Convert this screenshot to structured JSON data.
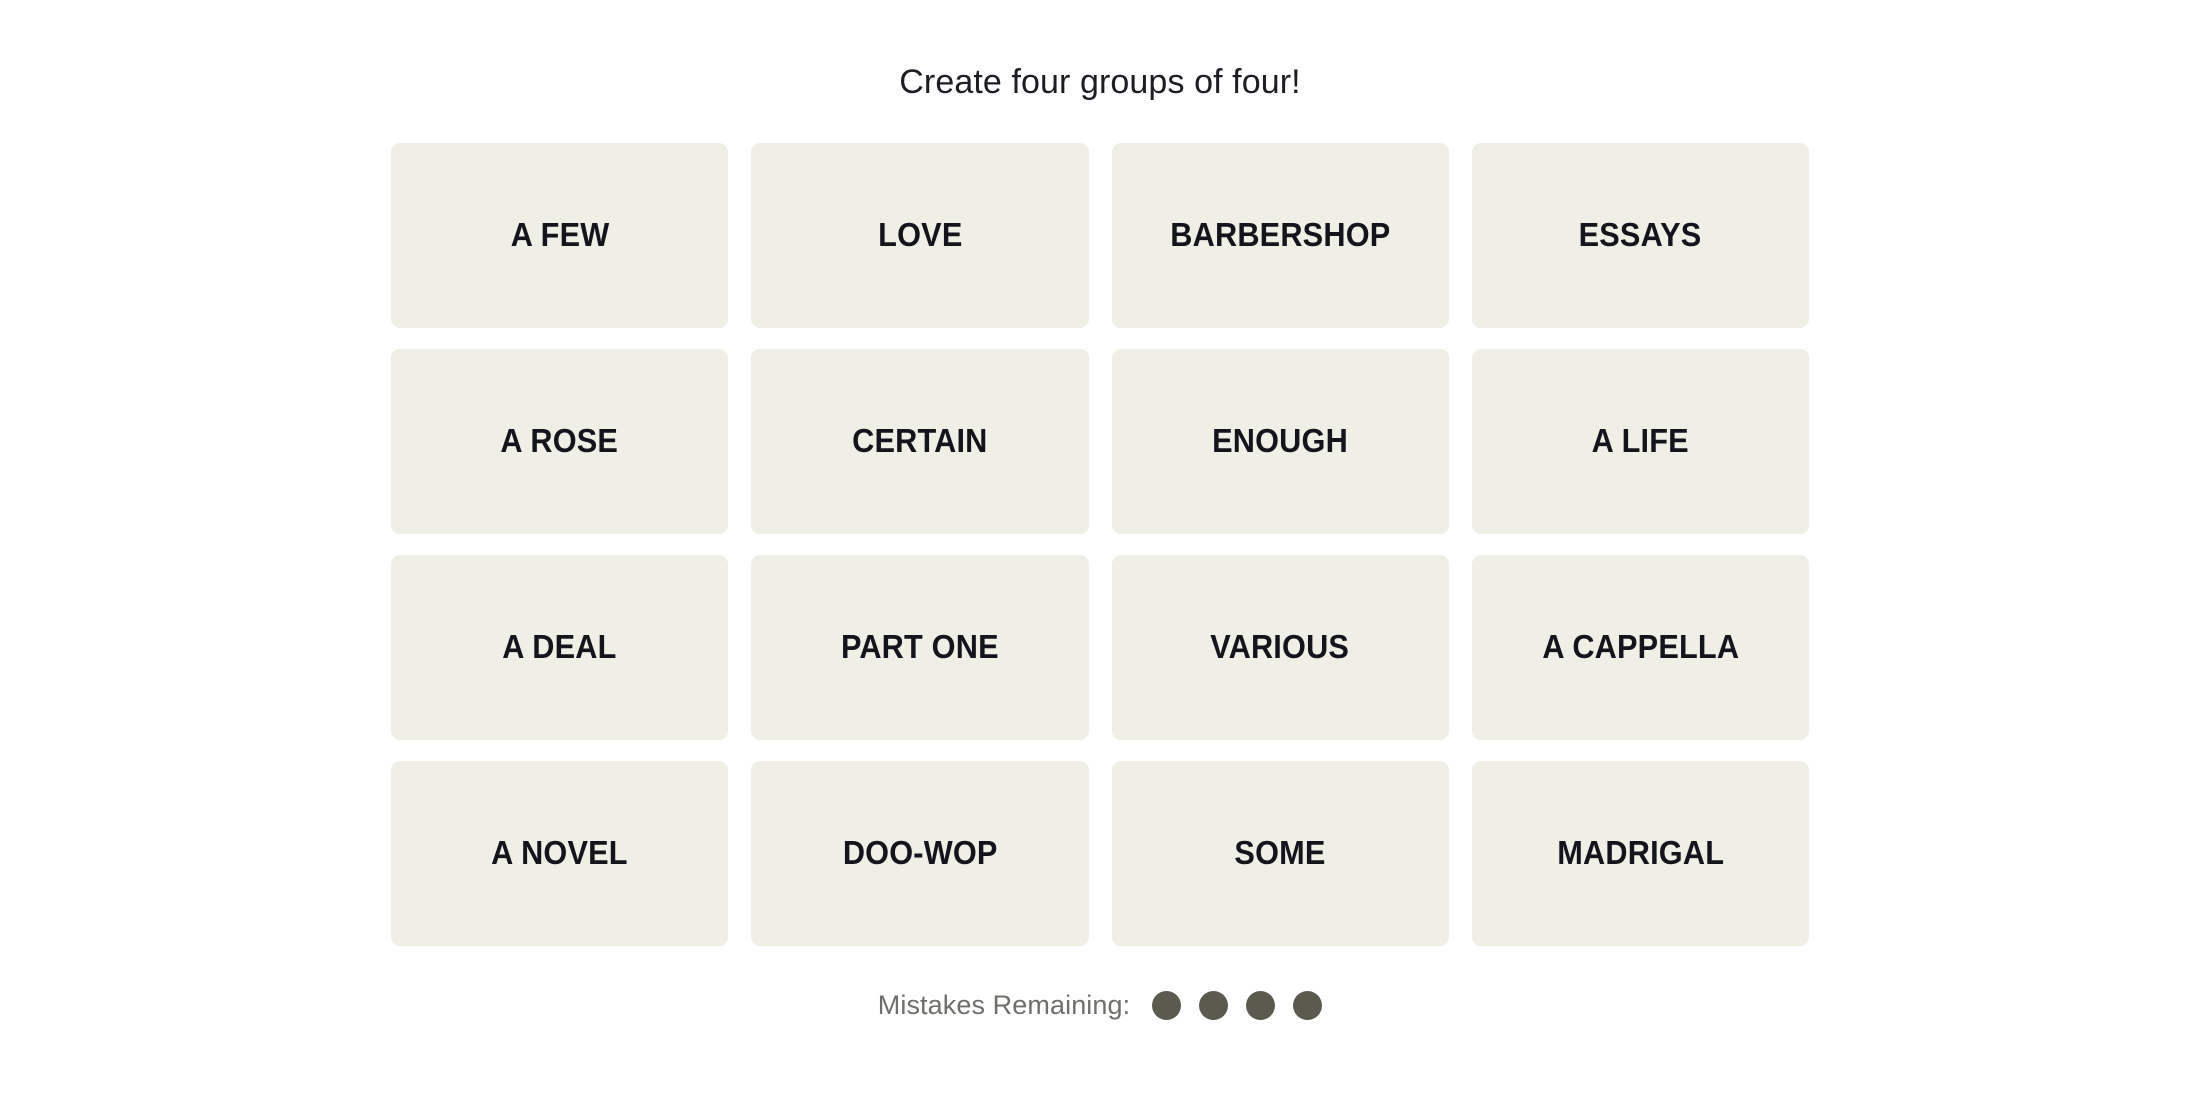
{
  "page": {
    "background_color": "#ffffff",
    "title": "Create four groups of four!"
  },
  "board": {
    "tile_color": "#efefe6",
    "tile_text_color": "#14141c",
    "rows": [
      [
        {
          "label": "A FEW"
        },
        {
          "label": "LOVE"
        },
        {
          "label": "BARBERSHOP"
        },
        {
          "label": "ESSAYS"
        }
      ],
      [
        {
          "label": "A ROSE"
        },
        {
          "label": "CERTAIN"
        },
        {
          "label": "ENOUGH"
        },
        {
          "label": "A LIFE"
        }
      ],
      [
        {
          "label": "A DEAL"
        },
        {
          "label": "PART ONE"
        },
        {
          "label": "VARIOUS"
        },
        {
          "label": "A CAPPELLA"
        }
      ],
      [
        {
          "label": "A NOVEL"
        },
        {
          "label": "DOO-WOP"
        },
        {
          "label": "SOME"
        },
        {
          "label": "MADRIGAL"
        }
      ]
    ]
  },
  "mistakes": {
    "label": "Mistakes Remaining:",
    "label_color": "#6f6f6a",
    "dot_color": "#5a5a4e",
    "remaining": 4,
    "total": 4
  }
}
